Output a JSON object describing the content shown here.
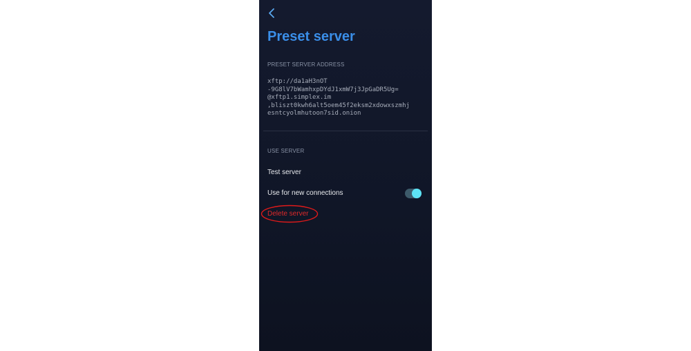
{
  "page": {
    "title": "Preset server",
    "back_icon": "chevron-left-icon"
  },
  "address_section": {
    "label": "PRESET SERVER ADDRESS",
    "lines": [
      "xftp://da1aH3nOT",
      "-9G8lV7bWamhxpDYdJ1xmW7j3JpGaDR5Ug=",
      "@xftp1.simplex.im",
      ",bliszt0kwh6alt5oem45f2eksm2xdowxszmhj",
      "esntcyolmhutoon7sid.onion"
    ]
  },
  "use_section": {
    "label": "USE SERVER",
    "test_label": "Test server",
    "new_connections_label": "Use for new connections",
    "new_connections_enabled": true,
    "delete_label": "Delete server"
  },
  "colors": {
    "accent": "#3a8ee8",
    "danger": "#e02a2a",
    "toggle_on": "#5de3f5"
  }
}
